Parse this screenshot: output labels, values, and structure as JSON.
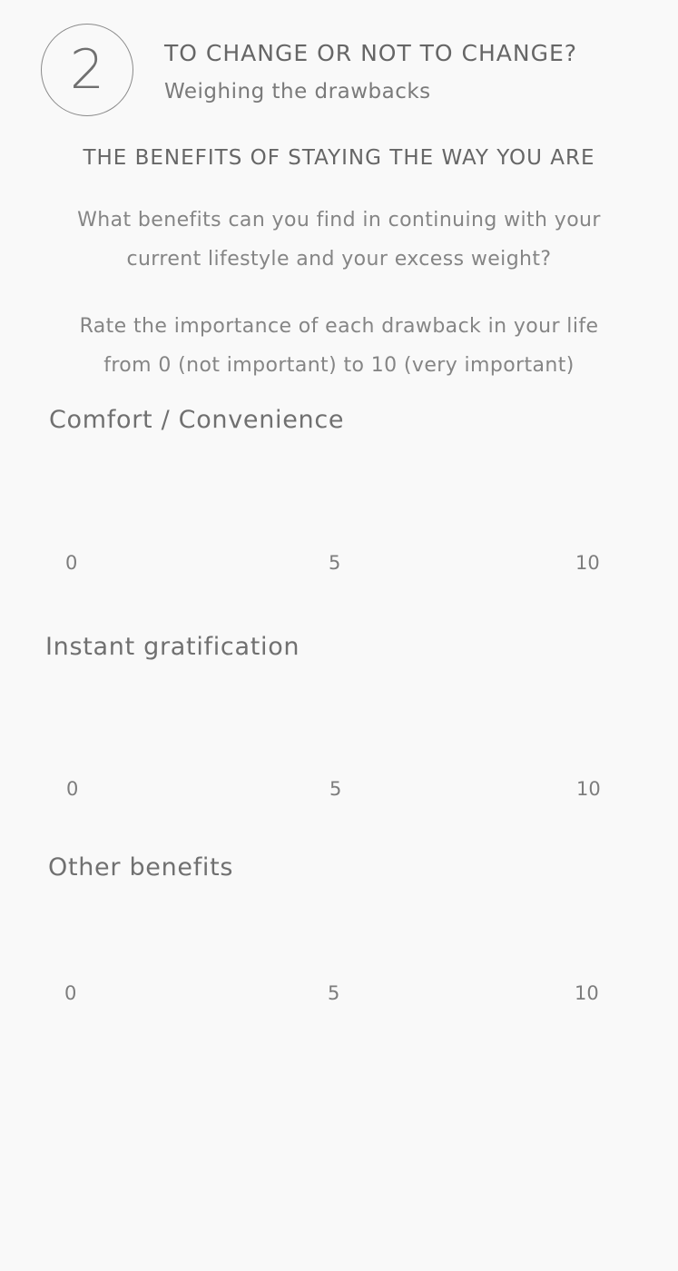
{
  "header": {
    "step_number": "2",
    "title": "TO CHANGE OR NOT TO CHANGE?",
    "subtitle": "Weighing the drawbacks"
  },
  "section": {
    "title": "THE BENEFITS OF STAYING THE WAY YOU ARE",
    "question_line1": "What benefits can you find in continuing with your",
    "question_line2": "current lifestyle and your excess weight?",
    "instruction_line1": "Rate the importance of each drawback in your life",
    "instruction_line2": "from 0 (not important) to 10 (very important)"
  },
  "ratings": [
    {
      "label": "Comfort / Convenience",
      "scale_min": "0",
      "scale_mid": "5",
      "scale_max": "10"
    },
    {
      "label": "Instant gratification",
      "scale_min": "0",
      "scale_mid": "5",
      "scale_max": "10"
    },
    {
      "label": "Other benefits",
      "scale_min": "0",
      "scale_mid": "5",
      "scale_max": "10"
    }
  ]
}
